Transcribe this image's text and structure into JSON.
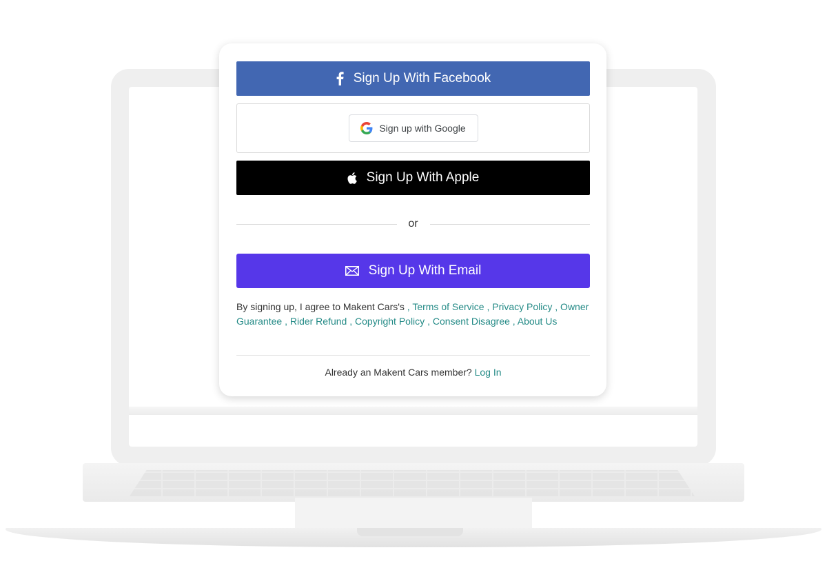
{
  "buttons": {
    "facebook_label": "Sign Up With Facebook",
    "google_label": "Sign up with Google",
    "apple_label": "Sign Up With Apple",
    "email_label": "Sign Up With Email"
  },
  "divider_text": "or",
  "terms": {
    "prefix": "By signing up, I agree to Makent Cars's",
    "links": [
      ", Terms of Service",
      ", Privacy Policy",
      ", Owner Guarantee",
      ", Rider Refund",
      ", Copyright Policy",
      ", Consent Disagree",
      ", About Us"
    ]
  },
  "footer": {
    "text": "Already an Makent Cars member?",
    "login_label": "Log In"
  },
  "icons": {
    "facebook": "facebook-icon",
    "google": "google-icon",
    "apple": "apple-icon",
    "email": "envelope-icon"
  },
  "colors": {
    "facebook": "#4267b2",
    "apple": "#000000",
    "email": "#5637e9",
    "link": "#238a86"
  }
}
